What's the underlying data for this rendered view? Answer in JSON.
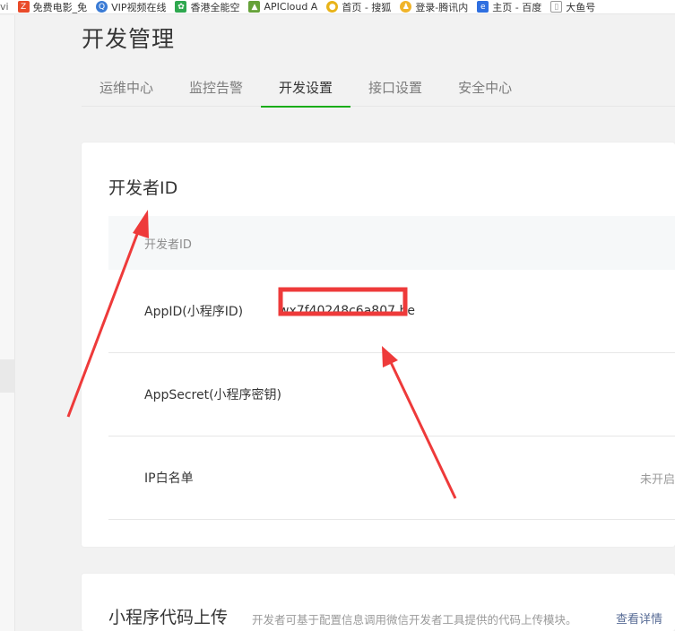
{
  "bookmarks": [
    {
      "label": "vi",
      "icon": "partial-icon",
      "color": "#999999"
    },
    {
      "label": "免费电影_免",
      "icon": "z-logo-icon",
      "color": "#e94b2a"
    },
    {
      "label": "VIP视频在线",
      "icon": "q-logo-icon",
      "color": "#3a7bd5"
    },
    {
      "label": "香港全能空",
      "icon": "leaf-icon",
      "color": "#2fa84f"
    },
    {
      "label": "APICloud A",
      "icon": "apicloud-icon",
      "color": "#66a23a"
    },
    {
      "label": "首页 - 搜狐",
      "icon": "sohu-icon",
      "color": "#e8b319"
    },
    {
      "label": "登录-腾讯内",
      "icon": "penguin-icon",
      "color": "#f0b429"
    },
    {
      "label": "主页 - 百度",
      "icon": "baidu-icon",
      "color": "#2f6fe0"
    },
    {
      "label": "大鱼号",
      "icon": "page-icon",
      "color": "#888888"
    }
  ],
  "page": {
    "title": "开发管理"
  },
  "tabs": [
    {
      "label": "运维中心",
      "active": false
    },
    {
      "label": "监控告警",
      "active": false
    },
    {
      "label": "开发设置",
      "active": true
    },
    {
      "label": "接口设置",
      "active": false
    },
    {
      "label": "安全中心",
      "active": false
    }
  ],
  "dev_id_card": {
    "title": "开发者ID",
    "table_header": "开发者ID",
    "rows": [
      {
        "label": "AppID(小程序ID)",
        "value": "wx7f40248c6a807   be"
      },
      {
        "label": "AppSecret(小程序密钥)",
        "value": ""
      },
      {
        "label": "IP白名单",
        "value": "",
        "status": "未开启"
      }
    ]
  },
  "upload_card": {
    "title": "小程序代码上传",
    "description": "开发者可基于配置信息调用微信开发者工具提供的代码上传模块。",
    "link": "查看详情"
  },
  "colors": {
    "accent_green": "#1aad19",
    "annotation_red": "#ee3a3a",
    "link_blue": "#576b95"
  }
}
